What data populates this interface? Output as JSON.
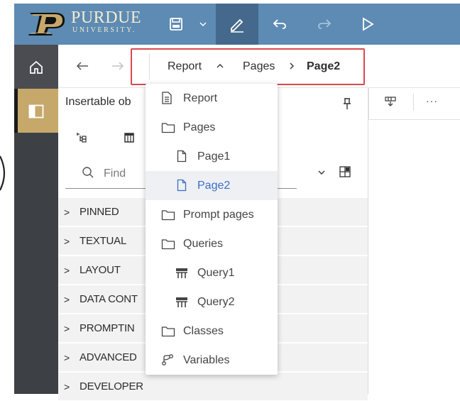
{
  "header": {
    "logo_name": "PURDUE",
    "logo_sub": "UNIVERSITY.",
    "icons": [
      "save-icon",
      "chevron-down-icon",
      "edit-pencil-icon",
      "undo-icon",
      "redo-icon",
      "run-play-icon"
    ],
    "colors": {
      "bar": "#5d8bb3",
      "active_tool": "#44698c",
      "logo_gold": "#c5a86a"
    }
  },
  "breadcrumb": {
    "items": [
      "Report",
      "Pages",
      "Page2"
    ],
    "highlight_color": "#d9484d"
  },
  "panel": {
    "title": "Insertable ob",
    "find_placeholder": "Find",
    "categories": [
      "PINNED",
      "TEXTUAL",
      "LAYOUT",
      "DATA CONT",
      "PROMPTIN",
      "ADVANCED",
      "DEVELOPER"
    ]
  },
  "dropdown": {
    "items": [
      {
        "label": "Report",
        "icon": "report-icon"
      },
      {
        "label": "Pages",
        "icon": "folder-icon"
      },
      {
        "label": "Page1",
        "icon": "page-icon"
      },
      {
        "label": "Page2",
        "icon": "page-icon",
        "selected": true
      },
      {
        "label": "Prompt pages",
        "icon": "folder-icon"
      },
      {
        "label": "Queries",
        "icon": "folder-icon"
      },
      {
        "label": "Query1",
        "icon": "query-icon"
      },
      {
        "label": "Query2",
        "icon": "query-icon"
      },
      {
        "label": "Classes",
        "icon": "folder-icon"
      },
      {
        "label": "Variables",
        "icon": "variables-icon"
      }
    ],
    "selected_color": "#3a6fc4"
  },
  "right_toolbar": {
    "icons": [
      "insert-column-icon",
      "more-icon"
    ]
  }
}
